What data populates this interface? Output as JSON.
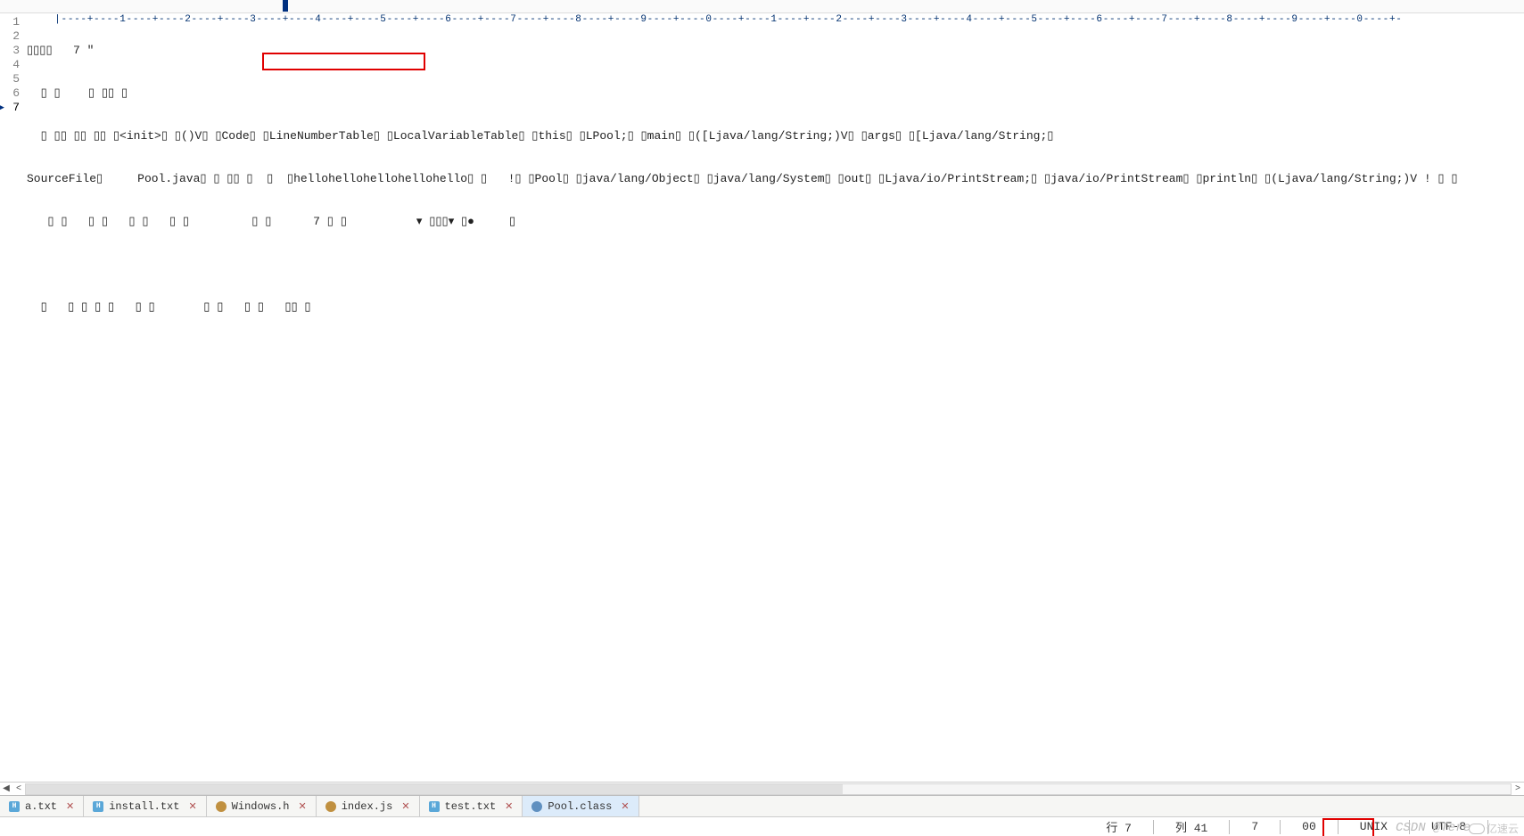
{
  "ruler_text": "|----+----1----+----2----+----3----+----4----+----5----+----6----+----7----+----8----+----9----+----0----+----1----+----2----+----3----+----4----+----5----+----6----+----7----+----8----+----9----+----0----+-",
  "lines": [
    "1",
    "2",
    "3",
    "4",
    "5",
    "6",
    "7"
  ],
  "current_line_index": 6,
  "code_rows": [
    "▯▯▯▯   7 \"",
    "  ▯ ▯    ▯ ▯▯ ▯",
    "  ▯ ▯▯ ▯▯ ▯▯ ▯<init>▯ ▯()V▯ ▯Code▯ ▯LineNumberTable▯ ▯LocalVariableTable▯ ▯this▯ ▯LPool;▯ ▯main▯ ▯([Ljava/lang/String;)V▯ ▯args▯ ▯[Ljava/lang/String;▯",
    "SourceFile▯     Pool.java▯ ▯ ▯▯ ▯  ▯  ▯hellohellohellohellohello▯ ▯   !▯ ▯Pool▯ ▯java/lang/Object▯ ▯java/lang/System▯ ▯out▯ ▯Ljava/io/PrintStream;▯ ▯java/io/PrintStream▯ ▯println▯ ▯(Ljava/lang/String;)V ! ▯ ▯",
    "   ▯ ▯   ▯ ▯   ▯ ▯   ▯ ▯         ▯ ▯      7 ▯ ▯          ▾ ▯▯▯▾ ▯●     ▯",
    "",
    "  ▯   ▯ ▯ ▯ ▯   ▯ ▯       ▯ ▯   ▯ ▯   ▯▯ ▯"
  ],
  "tabs": [
    {
      "label": "a.txt",
      "icon": "h",
      "active": false
    },
    {
      "label": "install.txt",
      "icon": "h",
      "active": false
    },
    {
      "label": "Windows.h",
      "icon": "js",
      "active": false
    },
    {
      "label": "index.js",
      "icon": "js",
      "active": false
    },
    {
      "label": "test.txt",
      "icon": "h",
      "active": false
    },
    {
      "label": "Pool.class",
      "icon": "class",
      "active": true
    }
  ],
  "status": {
    "line_lbl": "行 7",
    "col_lbl": "列 41",
    "sel": "7",
    "ins": "00",
    "eol": "UNIX",
    "enc": "UTF-8"
  },
  "watermark": "CSDN @Tere",
  "watermark2": "亿速云"
}
